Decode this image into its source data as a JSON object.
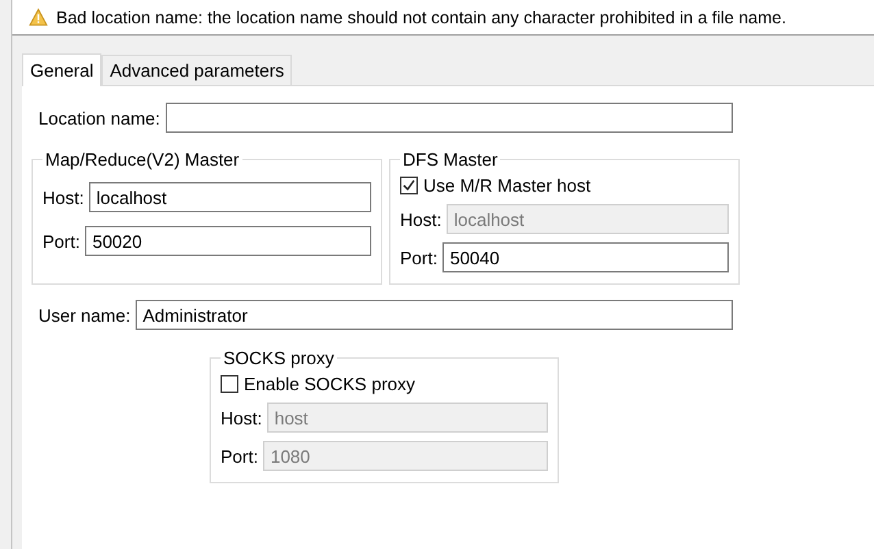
{
  "message": {
    "text": "Bad location name: the location name should not contain any character prohibited in a file name."
  },
  "tabs": [
    {
      "label": "General",
      "selected": true
    },
    {
      "label": "Advanced parameters",
      "selected": false
    }
  ],
  "location_name": {
    "label": "Location name:"
  },
  "mr_master": {
    "title": "Map/Reduce(V2) Master",
    "host": {
      "label": "Host:",
      "value": "localhost",
      "disabled": false
    },
    "port": {
      "label": "Port:",
      "value": "50020",
      "disabled": false
    }
  },
  "dfs_master": {
    "title": "DFS Master",
    "use_mr_host": {
      "label": "Use M/R Master host",
      "checked": true
    },
    "host": {
      "label": "Host:",
      "value": "localhost",
      "disabled": true
    },
    "port": {
      "label": "Port:",
      "value": "50040",
      "disabled": false
    }
  },
  "user_name": {
    "label": "User name:",
    "value": "Administrator"
  },
  "socks_proxy": {
    "title": "SOCKS proxy",
    "enable": {
      "label": "Enable SOCKS proxy",
      "checked": false
    },
    "host": {
      "label": "Host:",
      "value": "host",
      "disabled": true
    },
    "port": {
      "label": "Port:",
      "value": "1080",
      "disabled": true
    }
  }
}
